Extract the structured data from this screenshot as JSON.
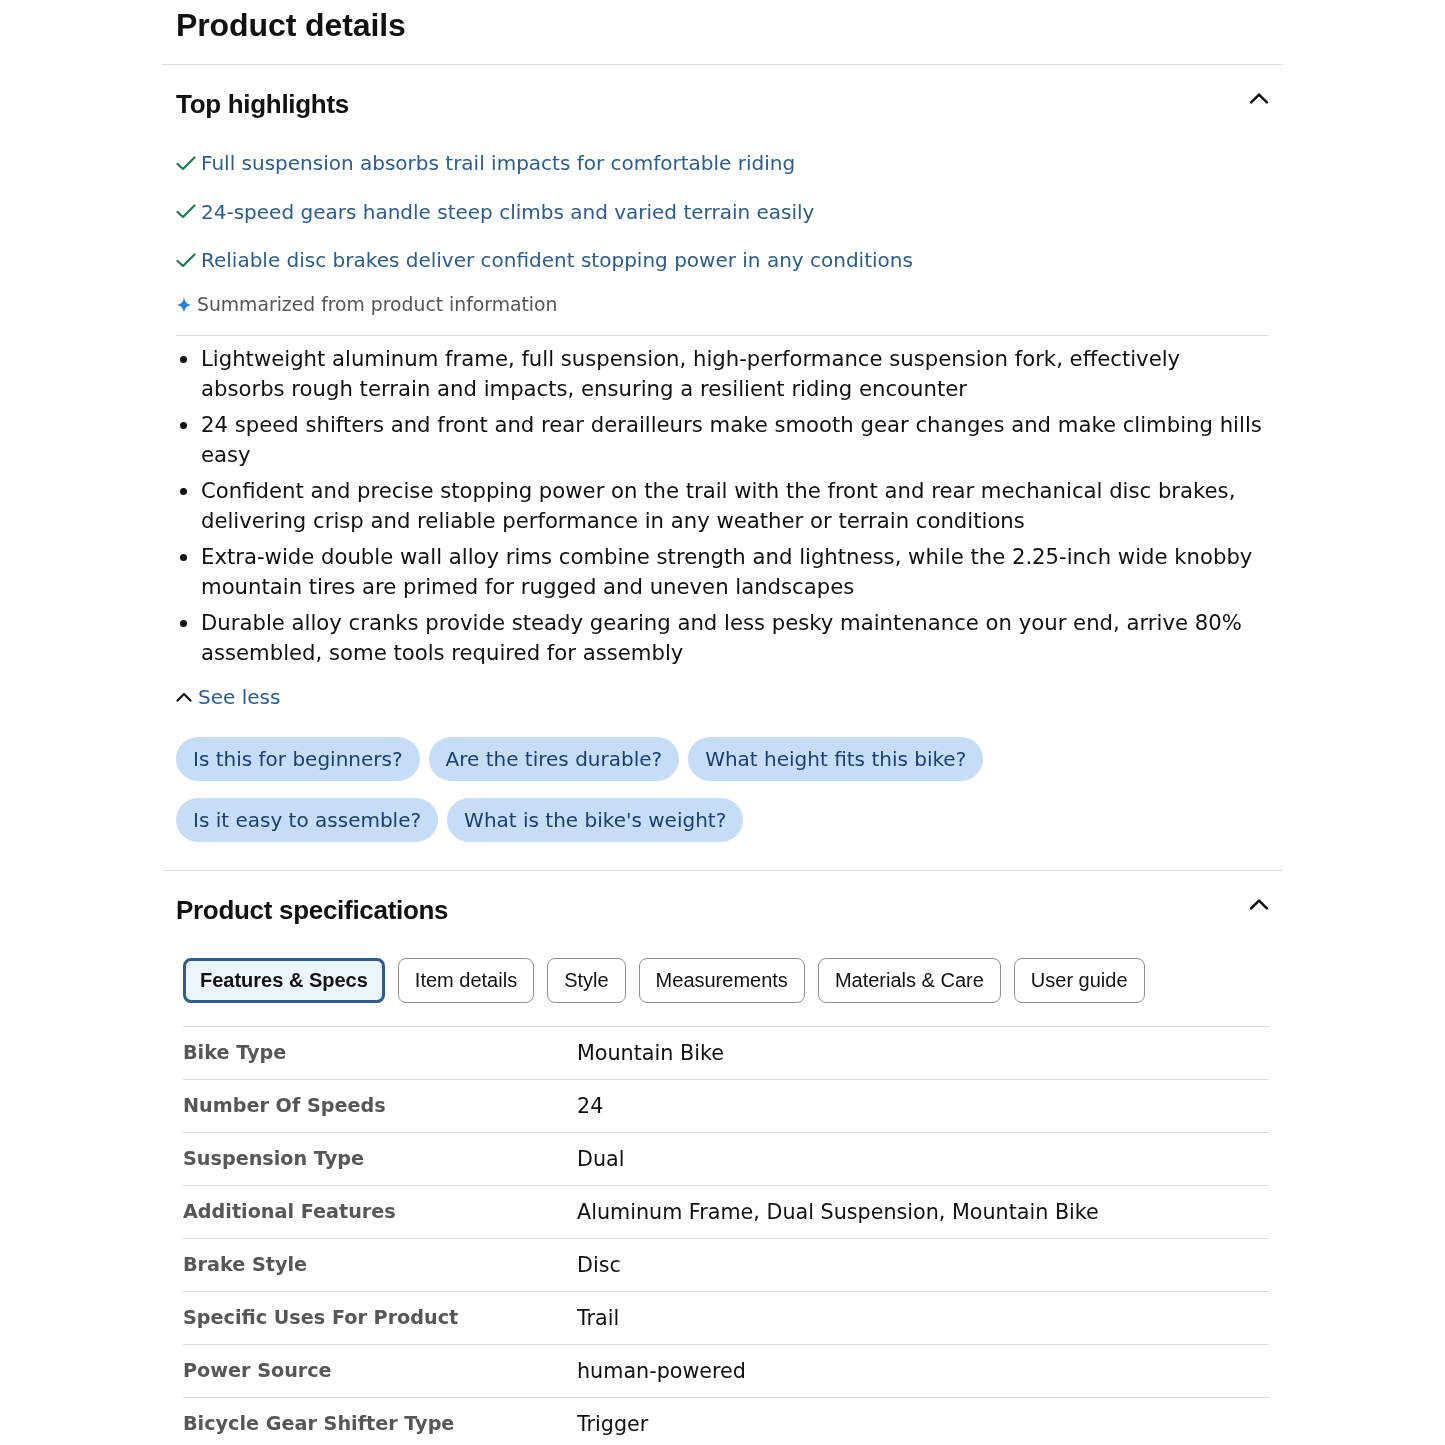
{
  "page_title": "Product details",
  "top_highlights": {
    "title": "Top highlights",
    "expanded": true,
    "highlights": [
      "Full suspension absorbs trail impacts for comfortable riding",
      "24-speed gears handle steep climbs and varied terrain easily",
      "Reliable disc brakes deliver confident stopping power in any conditions"
    ],
    "summary_note": "Summarized from product information",
    "details_expanded": true,
    "bullets": [
      "Lightweight aluminum frame, full suspension, high-performance suspension fork, effectively absorbs rough terrain and impacts, ensuring a resilient riding encounter",
      "24 speed shifters and front and rear derailleurs make smooth gear changes and make climbing hills easy",
      "Confident and precise stopping power on the trail with the front and rear mechanical disc brakes, delivering crisp and reliable performance in any weather or terrain conditions",
      "Extra-wide double wall alloy rims combine strength and lightness, while the 2.25-inch wide knobby mountain tires are primed for rugged and uneven landscapes",
      "Durable alloy cranks provide steady gearing and less pesky maintenance on your end, arrive 80% assembled, some tools required for assembly"
    ],
    "toggle_label": "See less",
    "suggested_questions": [
      "Is this for beginners?",
      "Are the tires durable?",
      "What height fits this bike?",
      "Is it easy to assemble?",
      "What is the bike's weight?"
    ]
  },
  "product_specifications": {
    "title": "Product specifications",
    "expanded": true,
    "tabs": [
      {
        "label": "Features & Specs",
        "selected": true
      },
      {
        "label": "Item details",
        "selected": false
      },
      {
        "label": "Style",
        "selected": false
      },
      {
        "label": "Measurements",
        "selected": false
      },
      {
        "label": "Materials & Care",
        "selected": false
      },
      {
        "label": "User guide",
        "selected": false
      }
    ],
    "specs": [
      {
        "label": "Bike Type",
        "value": "Mountain Bike"
      },
      {
        "label": "Number Of Speeds",
        "value": "24"
      },
      {
        "label": "Suspension Type",
        "value": "Dual"
      },
      {
        "label": "Additional Features",
        "value": "Aluminum Frame, Dual Suspension, Mountain Bike"
      },
      {
        "label": "Brake Style",
        "value": "Disc"
      },
      {
        "label": "Specific Uses For Product",
        "value": "Trail"
      },
      {
        "label": "Power Source",
        "value": "human-powered"
      },
      {
        "label": "Bicycle Gear Shifter Type",
        "value": "Trigger"
      }
    ]
  }
}
